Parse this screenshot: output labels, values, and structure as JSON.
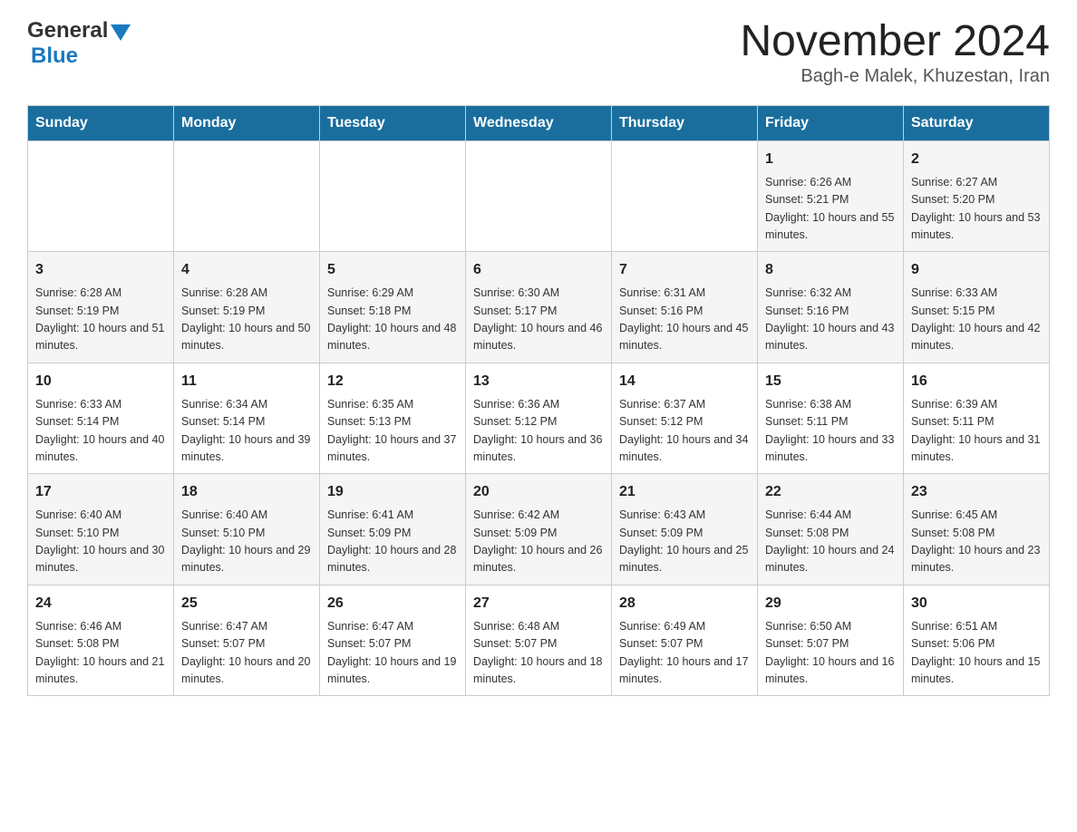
{
  "header": {
    "logo": {
      "general": "General",
      "blue": "Blue"
    },
    "title": "November 2024",
    "subtitle": "Bagh-e Malek, Khuzestan, Iran"
  },
  "calendar": {
    "days_of_week": [
      "Sunday",
      "Monday",
      "Tuesday",
      "Wednesday",
      "Thursday",
      "Friday",
      "Saturday"
    ],
    "weeks": [
      {
        "days": [
          {
            "number": "",
            "info": ""
          },
          {
            "number": "",
            "info": ""
          },
          {
            "number": "",
            "info": ""
          },
          {
            "number": "",
            "info": ""
          },
          {
            "number": "",
            "info": ""
          },
          {
            "number": "1",
            "info": "Sunrise: 6:26 AM\nSunset: 5:21 PM\nDaylight: 10 hours and 55 minutes."
          },
          {
            "number": "2",
            "info": "Sunrise: 6:27 AM\nSunset: 5:20 PM\nDaylight: 10 hours and 53 minutes."
          }
        ]
      },
      {
        "days": [
          {
            "number": "3",
            "info": "Sunrise: 6:28 AM\nSunset: 5:19 PM\nDaylight: 10 hours and 51 minutes."
          },
          {
            "number": "4",
            "info": "Sunrise: 6:28 AM\nSunset: 5:19 PM\nDaylight: 10 hours and 50 minutes."
          },
          {
            "number": "5",
            "info": "Sunrise: 6:29 AM\nSunset: 5:18 PM\nDaylight: 10 hours and 48 minutes."
          },
          {
            "number": "6",
            "info": "Sunrise: 6:30 AM\nSunset: 5:17 PM\nDaylight: 10 hours and 46 minutes."
          },
          {
            "number": "7",
            "info": "Sunrise: 6:31 AM\nSunset: 5:16 PM\nDaylight: 10 hours and 45 minutes."
          },
          {
            "number": "8",
            "info": "Sunrise: 6:32 AM\nSunset: 5:16 PM\nDaylight: 10 hours and 43 minutes."
          },
          {
            "number": "9",
            "info": "Sunrise: 6:33 AM\nSunset: 5:15 PM\nDaylight: 10 hours and 42 minutes."
          }
        ]
      },
      {
        "days": [
          {
            "number": "10",
            "info": "Sunrise: 6:33 AM\nSunset: 5:14 PM\nDaylight: 10 hours and 40 minutes."
          },
          {
            "number": "11",
            "info": "Sunrise: 6:34 AM\nSunset: 5:14 PM\nDaylight: 10 hours and 39 minutes."
          },
          {
            "number": "12",
            "info": "Sunrise: 6:35 AM\nSunset: 5:13 PM\nDaylight: 10 hours and 37 minutes."
          },
          {
            "number": "13",
            "info": "Sunrise: 6:36 AM\nSunset: 5:12 PM\nDaylight: 10 hours and 36 minutes."
          },
          {
            "number": "14",
            "info": "Sunrise: 6:37 AM\nSunset: 5:12 PM\nDaylight: 10 hours and 34 minutes."
          },
          {
            "number": "15",
            "info": "Sunrise: 6:38 AM\nSunset: 5:11 PM\nDaylight: 10 hours and 33 minutes."
          },
          {
            "number": "16",
            "info": "Sunrise: 6:39 AM\nSunset: 5:11 PM\nDaylight: 10 hours and 31 minutes."
          }
        ]
      },
      {
        "days": [
          {
            "number": "17",
            "info": "Sunrise: 6:40 AM\nSunset: 5:10 PM\nDaylight: 10 hours and 30 minutes."
          },
          {
            "number": "18",
            "info": "Sunrise: 6:40 AM\nSunset: 5:10 PM\nDaylight: 10 hours and 29 minutes."
          },
          {
            "number": "19",
            "info": "Sunrise: 6:41 AM\nSunset: 5:09 PM\nDaylight: 10 hours and 28 minutes."
          },
          {
            "number": "20",
            "info": "Sunrise: 6:42 AM\nSunset: 5:09 PM\nDaylight: 10 hours and 26 minutes."
          },
          {
            "number": "21",
            "info": "Sunrise: 6:43 AM\nSunset: 5:09 PM\nDaylight: 10 hours and 25 minutes."
          },
          {
            "number": "22",
            "info": "Sunrise: 6:44 AM\nSunset: 5:08 PM\nDaylight: 10 hours and 24 minutes."
          },
          {
            "number": "23",
            "info": "Sunrise: 6:45 AM\nSunset: 5:08 PM\nDaylight: 10 hours and 23 minutes."
          }
        ]
      },
      {
        "days": [
          {
            "number": "24",
            "info": "Sunrise: 6:46 AM\nSunset: 5:08 PM\nDaylight: 10 hours and 21 minutes."
          },
          {
            "number": "25",
            "info": "Sunrise: 6:47 AM\nSunset: 5:07 PM\nDaylight: 10 hours and 20 minutes."
          },
          {
            "number": "26",
            "info": "Sunrise: 6:47 AM\nSunset: 5:07 PM\nDaylight: 10 hours and 19 minutes."
          },
          {
            "number": "27",
            "info": "Sunrise: 6:48 AM\nSunset: 5:07 PM\nDaylight: 10 hours and 18 minutes."
          },
          {
            "number": "28",
            "info": "Sunrise: 6:49 AM\nSunset: 5:07 PM\nDaylight: 10 hours and 17 minutes."
          },
          {
            "number": "29",
            "info": "Sunrise: 6:50 AM\nSunset: 5:07 PM\nDaylight: 10 hours and 16 minutes."
          },
          {
            "number": "30",
            "info": "Sunrise: 6:51 AM\nSunset: 5:06 PM\nDaylight: 10 hours and 15 minutes."
          }
        ]
      }
    ]
  }
}
